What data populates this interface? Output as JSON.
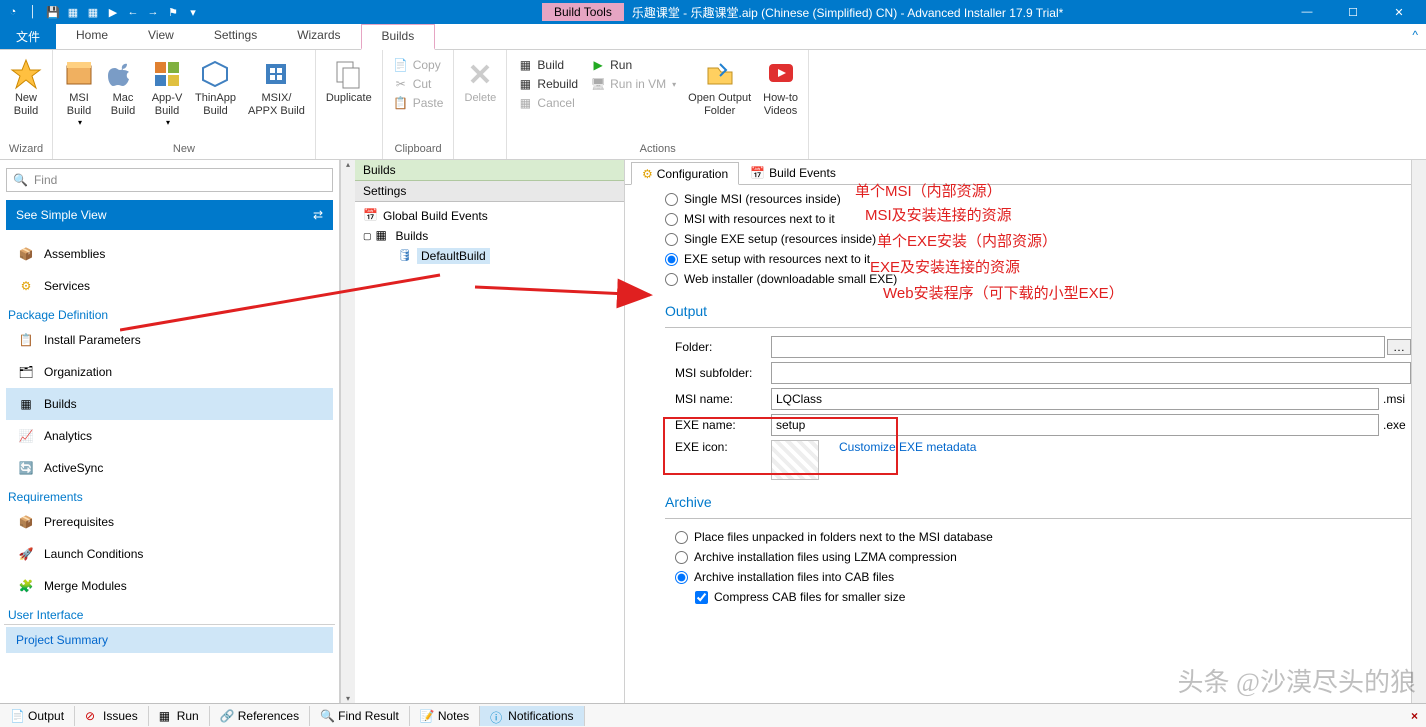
{
  "titlebar": {
    "build_tools": "Build Tools",
    "title": "乐趣课堂 - 乐趣课堂.aip (Chinese (Simplified) CN) - Advanced Installer 17.9 Trial*"
  },
  "menu": {
    "file": "文件",
    "home": "Home",
    "view": "View",
    "settings": "Settings",
    "wizards": "Wizards",
    "builds": "Builds"
  },
  "ribbon": {
    "wizard": {
      "label": "Wizard",
      "new_build": "New\nBuild"
    },
    "new_group": {
      "label": "New",
      "msi_build": "MSI\nBuild",
      "mac_build": "Mac\nBuild",
      "appv_build": "App-V\nBuild",
      "thinapp_build": "ThinApp\nBuild",
      "msix_build": "MSIX/\nAPPX Build"
    },
    "duplicate": "Duplicate",
    "clipboard": {
      "label": "Clipboard",
      "copy": "Copy",
      "cut": "Cut",
      "paste": "Paste"
    },
    "delete": "Delete",
    "actions": {
      "label": "Actions",
      "build": "Build",
      "rebuild": "Rebuild",
      "cancel": "Cancel",
      "run": "Run",
      "run_in_vm": "Run in VM",
      "open_output": "Open Output\nFolder",
      "howto": "How-to\nVideos"
    }
  },
  "nav": {
    "find_placeholder": "Find",
    "simple_view": "See Simple View",
    "items_top": [
      "Assemblies",
      "Services"
    ],
    "package_def": "Package Definition",
    "pd_items": [
      "Install Parameters",
      "Organization",
      "Builds",
      "Analytics",
      "ActiveSync"
    ],
    "requirements": "Requirements",
    "req_items": [
      "Prerequisites",
      "Launch Conditions",
      "Merge Modules"
    ],
    "ui": "User Interface",
    "project_summary": "Project Summary"
  },
  "center": {
    "builds_hdr": "Builds",
    "settings_hdr": "Settings",
    "global_events": "Global Build Events",
    "builds_node": "Builds",
    "default_build": "DefaultBuild"
  },
  "right": {
    "tab_config": "Configuration",
    "tab_events": "Build Events",
    "radios": {
      "r1": "Single MSI (resources inside)",
      "r2": "MSI with resources next to it",
      "r3": "Single EXE setup (resources inside)",
      "r4": "EXE setup with resources next to it",
      "r5": "Web installer (downloadable small EXE)"
    },
    "output": {
      "title": "Output",
      "folder": "Folder:",
      "folder_val": "",
      "msi_sub": "MSI subfolder:",
      "msi_sub_val": "",
      "msi_name": "MSI name:",
      "msi_name_val": "LQClass",
      "msi_ext": ".msi",
      "exe_name": "EXE name:",
      "exe_name_val": "setup",
      "exe_ext": ".exe",
      "exe_icon": "EXE icon:",
      "customize": "Customize EXE metadata"
    },
    "archive": {
      "title": "Archive",
      "a1": "Place files unpacked in folders next to the MSI database",
      "a2": "Archive installation files using LZMA compression",
      "a3": "Archive installation files into CAB files",
      "c1": "Compress CAB files for smaller size"
    }
  },
  "annotations": {
    "a1": "单个MSI（内部资源）",
    "a2": "MSI及安装连接的资源",
    "a3": "单个EXE安装（内部资源）",
    "a4": "EXE及安装连接的资源",
    "a5": "Web安装程序（可下载的小型EXE）"
  },
  "bottom": {
    "output": "Output",
    "issues": "Issues",
    "run": "Run",
    "references": "References",
    "find_result": "Find Result",
    "notes": "Notes",
    "notifications": "Notifications"
  },
  "watermark": "头条 @沙漠尽头的狼"
}
